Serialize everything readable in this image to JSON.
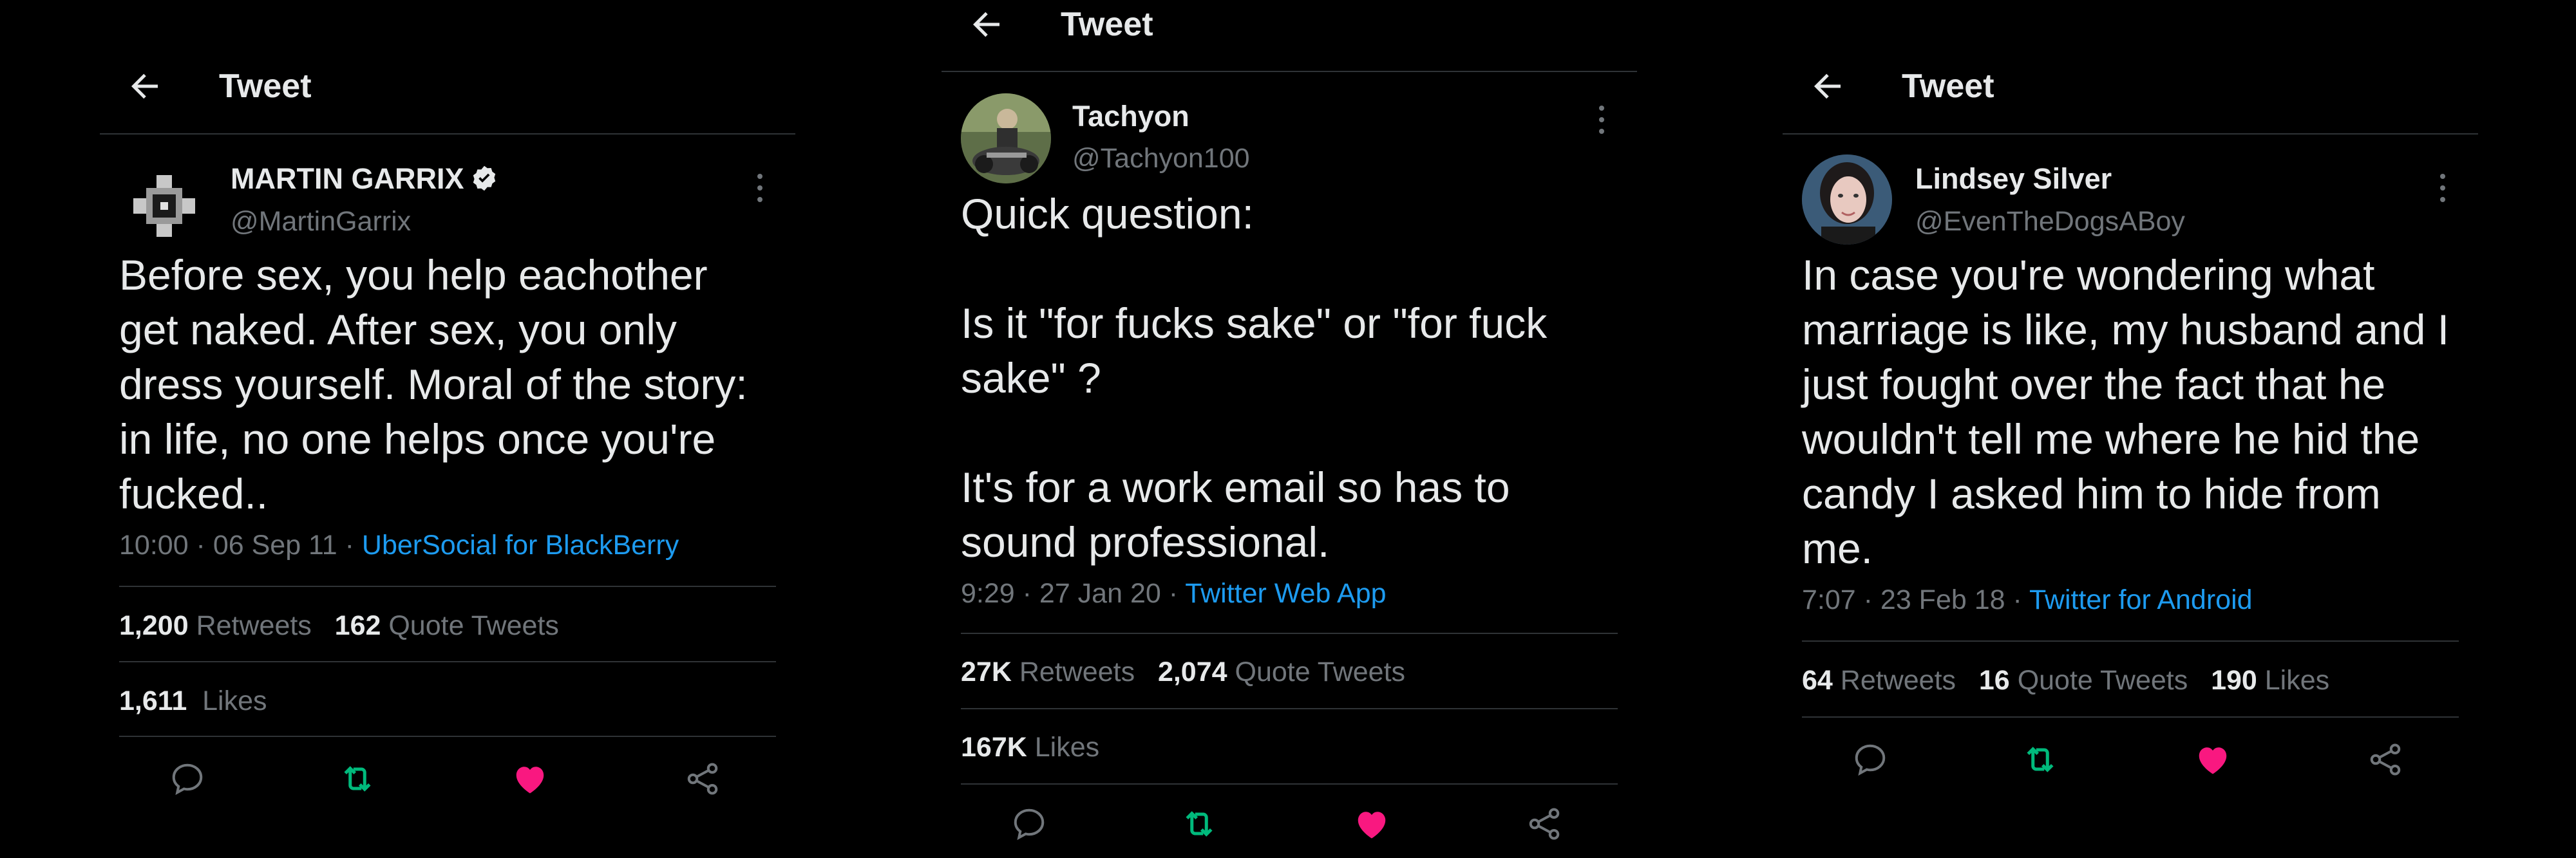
{
  "tweets": [
    {
      "header_title": "Tweet",
      "name": "MARTIN GARRIX",
      "handle": "@MartinGarrix",
      "verified": true,
      "text": "Before sex, you help eachother\nget naked. After sex, you only\ndress yourself. Moral of the story:\nin life, no one helps once you're\nfucked..",
      "time": "10:00 · 06 Sep 11",
      "source": "UberSocial for BlackBerry",
      "retweets": "1,200",
      "retweets_label": "Retweets",
      "quotes": "162",
      "quotes_label": "Quote Tweets",
      "likes": "1,611",
      "likes_label": "Likes"
    },
    {
      "header_title": "Tweet",
      "name": "Tachyon",
      "handle": "@Tachyon100",
      "verified": false,
      "text": "Quick question:\n\nIs it \"for fucks sake\" or \"for fuck\nsake\" ?\n\nIt's for a work email so has to\nsound professional.",
      "time": "9:29 · 27 Jan 20",
      "source": "Twitter Web App",
      "retweets": "27K",
      "retweets_label": "Retweets",
      "quotes": "2,074",
      "quotes_label": "Quote Tweets",
      "likes": "167K",
      "likes_label": "Likes"
    },
    {
      "header_title": "Tweet",
      "name": "Lindsey Silver",
      "handle": "@EvenTheDogsABoy",
      "verified": false,
      "text": "In case you're wondering what\nmarriage is like, my husband and I\njust fought over the fact that he\nwouldn't tell me where he hid the\ncandy I asked him to hide from\nme.",
      "time": "7:07 · 23 Feb 18",
      "source": "Twitter for Android",
      "retweets": "64",
      "retweets_label": "Retweets",
      "quotes": "16",
      "quotes_label": "Quote Tweets",
      "likes": "190",
      "likes_label": "Likes"
    }
  ],
  "colors": {
    "background": "#000000",
    "text": "#e7e9ea",
    "muted": "#71767b",
    "link": "#1d9bf0",
    "retweet": "#00ba7c",
    "like": "#f91880",
    "divider": "#2f3336"
  },
  "icons": [
    "back-arrow-icon",
    "verified-badge-icon",
    "more-options-icon",
    "reply-icon",
    "retweet-icon",
    "like-heart-icon",
    "share-icon"
  ]
}
